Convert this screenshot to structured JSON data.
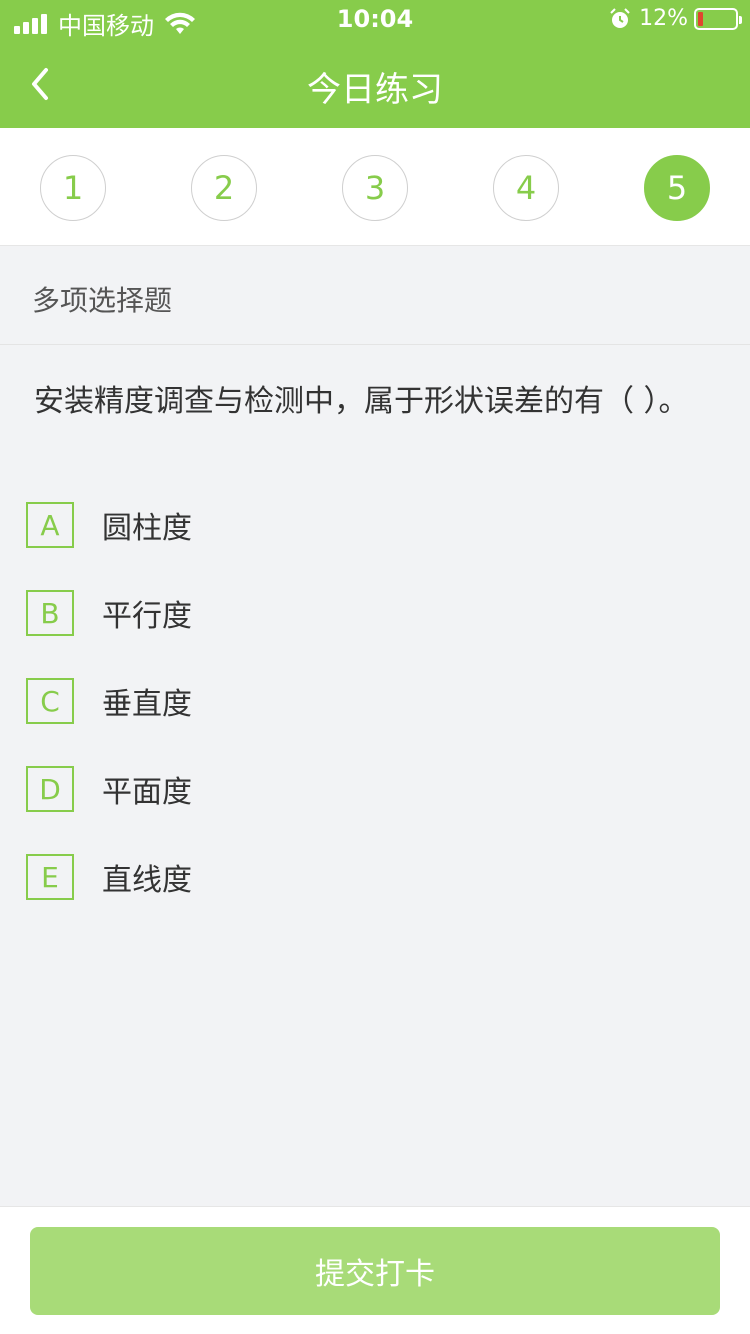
{
  "status_bar": {
    "carrier": "中国移动",
    "time": "10:04",
    "battery": "12%"
  },
  "header": {
    "title": "今日练习"
  },
  "question_numbers": [
    "1",
    "2",
    "3",
    "4",
    "5"
  ],
  "active_question": "5",
  "question": {
    "type": "多项选择题",
    "text": "安装精度调查与检测中，属于形状误差的有（    ）。",
    "options": [
      {
        "letter": "A",
        "text": "圆柱度"
      },
      {
        "letter": "B",
        "text": "平行度"
      },
      {
        "letter": "C",
        "text": "垂直度"
      },
      {
        "letter": "D",
        "text": "平面度"
      },
      {
        "letter": "E",
        "text": "直线度"
      }
    ]
  },
  "footer": {
    "submit_label": "提交打卡"
  },
  "colors": {
    "accent": "#87cc4b",
    "button_disabled": "#a8db78",
    "battery_low": "#e0452f"
  }
}
